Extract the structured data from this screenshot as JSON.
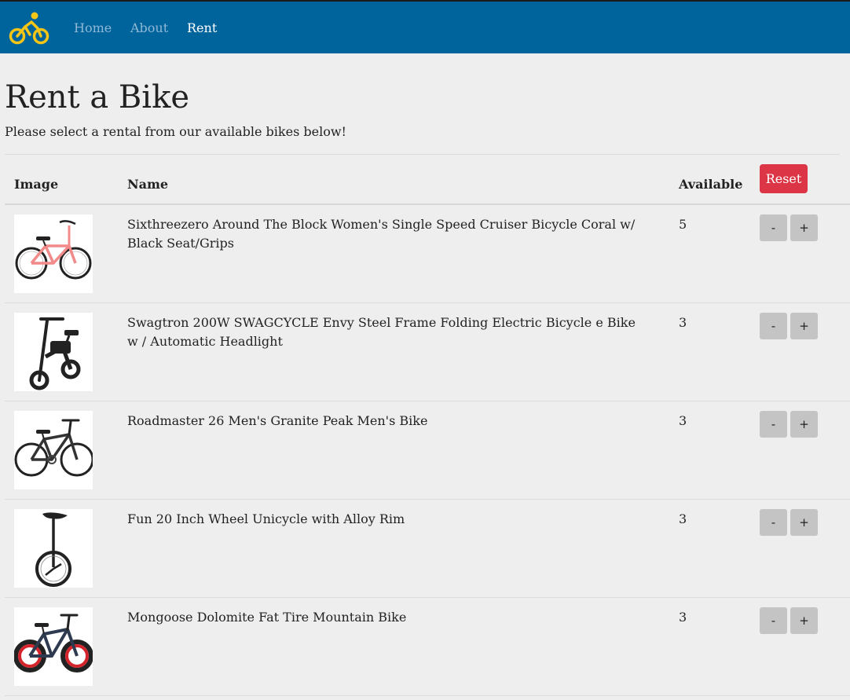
{
  "nav": {
    "brand_icon": "bicycle-icon",
    "brand_color": "#f5c518",
    "bar_color": "#00649c",
    "links": [
      {
        "label": "Home",
        "active": false
      },
      {
        "label": "About",
        "active": false
      },
      {
        "label": "Rent",
        "active": true
      }
    ]
  },
  "page": {
    "title": "Rent a Bike",
    "subtitle": "Please select a rental from our available bikes below!"
  },
  "table": {
    "headers": {
      "image": "Image",
      "name": "Name",
      "available": "Available"
    },
    "reset_label": "Reset",
    "reset_color": "#dc3545",
    "minus_label": "-",
    "plus_label": "+",
    "rows": [
      {
        "name": "Sixthreezero Around The Block Women's Single Speed Cruiser Bicycle Coral w/ Black Seat/Grips",
        "available": "5",
        "image": "coral-cruiser-bike-image"
      },
      {
        "name": "Swagtron 200W SWAGCYCLE Envy Steel Frame Folding Electric Bicycle e Bike w / Automatic Headlight",
        "available": "3",
        "image": "folding-ebike-image"
      },
      {
        "name": "Roadmaster 26 Men's Granite Peak Men's Bike",
        "available": "3",
        "image": "mountain-bike-image"
      },
      {
        "name": "Fun 20 Inch Wheel Unicycle with Alloy Rim",
        "available": "3",
        "image": "unicycle-image"
      },
      {
        "name": "Mongoose Dolomite Fat Tire Mountain Bike",
        "available": "3",
        "image": "fat-tire-bike-image"
      }
    ]
  }
}
